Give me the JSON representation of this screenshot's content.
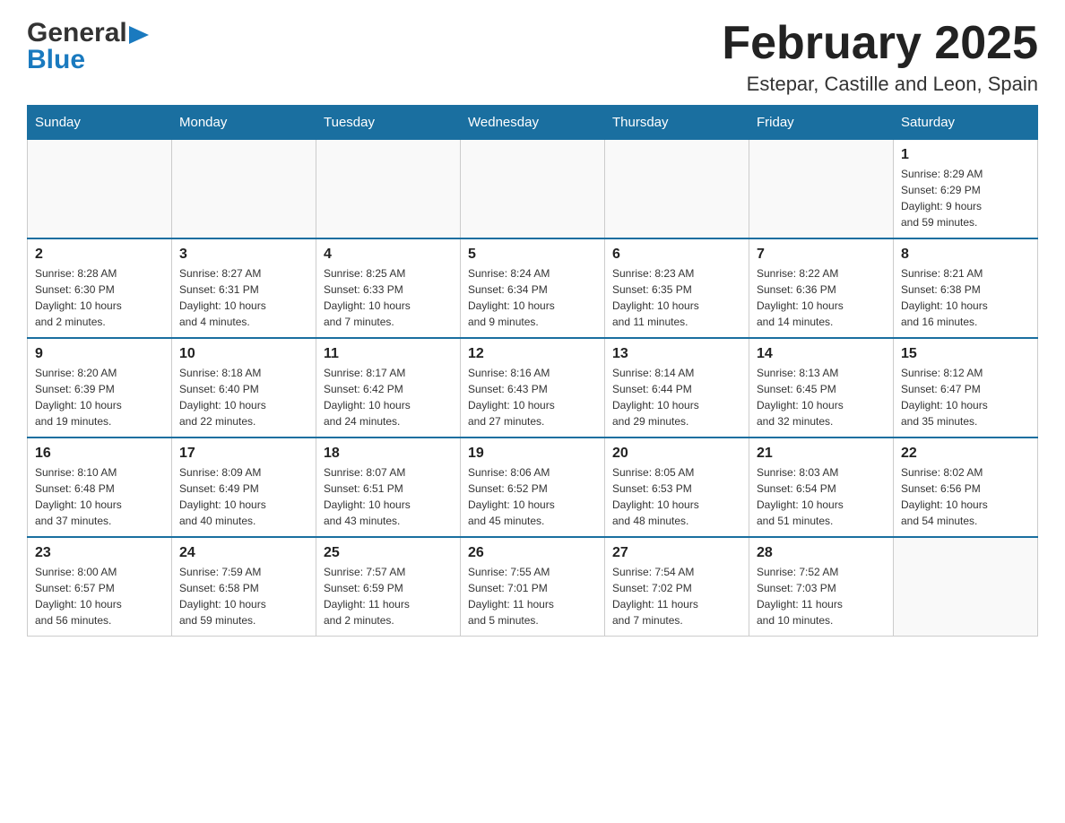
{
  "header": {
    "logo_general": "General",
    "logo_blue": "Blue",
    "month_title": "February 2025",
    "location": "Estepar, Castille and Leon, Spain"
  },
  "weekdays": [
    "Sunday",
    "Monday",
    "Tuesday",
    "Wednesday",
    "Thursday",
    "Friday",
    "Saturday"
  ],
  "weeks": [
    [
      {
        "day": "",
        "info": ""
      },
      {
        "day": "",
        "info": ""
      },
      {
        "day": "",
        "info": ""
      },
      {
        "day": "",
        "info": ""
      },
      {
        "day": "",
        "info": ""
      },
      {
        "day": "",
        "info": ""
      },
      {
        "day": "1",
        "info": "Sunrise: 8:29 AM\nSunset: 6:29 PM\nDaylight: 9 hours\nand 59 minutes."
      }
    ],
    [
      {
        "day": "2",
        "info": "Sunrise: 8:28 AM\nSunset: 6:30 PM\nDaylight: 10 hours\nand 2 minutes."
      },
      {
        "day": "3",
        "info": "Sunrise: 8:27 AM\nSunset: 6:31 PM\nDaylight: 10 hours\nand 4 minutes."
      },
      {
        "day": "4",
        "info": "Sunrise: 8:25 AM\nSunset: 6:33 PM\nDaylight: 10 hours\nand 7 minutes."
      },
      {
        "day": "5",
        "info": "Sunrise: 8:24 AM\nSunset: 6:34 PM\nDaylight: 10 hours\nand 9 minutes."
      },
      {
        "day": "6",
        "info": "Sunrise: 8:23 AM\nSunset: 6:35 PM\nDaylight: 10 hours\nand 11 minutes."
      },
      {
        "day": "7",
        "info": "Sunrise: 8:22 AM\nSunset: 6:36 PM\nDaylight: 10 hours\nand 14 minutes."
      },
      {
        "day": "8",
        "info": "Sunrise: 8:21 AM\nSunset: 6:38 PM\nDaylight: 10 hours\nand 16 minutes."
      }
    ],
    [
      {
        "day": "9",
        "info": "Sunrise: 8:20 AM\nSunset: 6:39 PM\nDaylight: 10 hours\nand 19 minutes."
      },
      {
        "day": "10",
        "info": "Sunrise: 8:18 AM\nSunset: 6:40 PM\nDaylight: 10 hours\nand 22 minutes."
      },
      {
        "day": "11",
        "info": "Sunrise: 8:17 AM\nSunset: 6:42 PM\nDaylight: 10 hours\nand 24 minutes."
      },
      {
        "day": "12",
        "info": "Sunrise: 8:16 AM\nSunset: 6:43 PM\nDaylight: 10 hours\nand 27 minutes."
      },
      {
        "day": "13",
        "info": "Sunrise: 8:14 AM\nSunset: 6:44 PM\nDaylight: 10 hours\nand 29 minutes."
      },
      {
        "day": "14",
        "info": "Sunrise: 8:13 AM\nSunset: 6:45 PM\nDaylight: 10 hours\nand 32 minutes."
      },
      {
        "day": "15",
        "info": "Sunrise: 8:12 AM\nSunset: 6:47 PM\nDaylight: 10 hours\nand 35 minutes."
      }
    ],
    [
      {
        "day": "16",
        "info": "Sunrise: 8:10 AM\nSunset: 6:48 PM\nDaylight: 10 hours\nand 37 minutes."
      },
      {
        "day": "17",
        "info": "Sunrise: 8:09 AM\nSunset: 6:49 PM\nDaylight: 10 hours\nand 40 minutes."
      },
      {
        "day": "18",
        "info": "Sunrise: 8:07 AM\nSunset: 6:51 PM\nDaylight: 10 hours\nand 43 minutes."
      },
      {
        "day": "19",
        "info": "Sunrise: 8:06 AM\nSunset: 6:52 PM\nDaylight: 10 hours\nand 45 minutes."
      },
      {
        "day": "20",
        "info": "Sunrise: 8:05 AM\nSunset: 6:53 PM\nDaylight: 10 hours\nand 48 minutes."
      },
      {
        "day": "21",
        "info": "Sunrise: 8:03 AM\nSunset: 6:54 PM\nDaylight: 10 hours\nand 51 minutes."
      },
      {
        "day": "22",
        "info": "Sunrise: 8:02 AM\nSunset: 6:56 PM\nDaylight: 10 hours\nand 54 minutes."
      }
    ],
    [
      {
        "day": "23",
        "info": "Sunrise: 8:00 AM\nSunset: 6:57 PM\nDaylight: 10 hours\nand 56 minutes."
      },
      {
        "day": "24",
        "info": "Sunrise: 7:59 AM\nSunset: 6:58 PM\nDaylight: 10 hours\nand 59 minutes."
      },
      {
        "day": "25",
        "info": "Sunrise: 7:57 AM\nSunset: 6:59 PM\nDaylight: 11 hours\nand 2 minutes."
      },
      {
        "day": "26",
        "info": "Sunrise: 7:55 AM\nSunset: 7:01 PM\nDaylight: 11 hours\nand 5 minutes."
      },
      {
        "day": "27",
        "info": "Sunrise: 7:54 AM\nSunset: 7:02 PM\nDaylight: 11 hours\nand 7 minutes."
      },
      {
        "day": "28",
        "info": "Sunrise: 7:52 AM\nSunset: 7:03 PM\nDaylight: 11 hours\nand 10 minutes."
      },
      {
        "day": "",
        "info": ""
      }
    ]
  ]
}
